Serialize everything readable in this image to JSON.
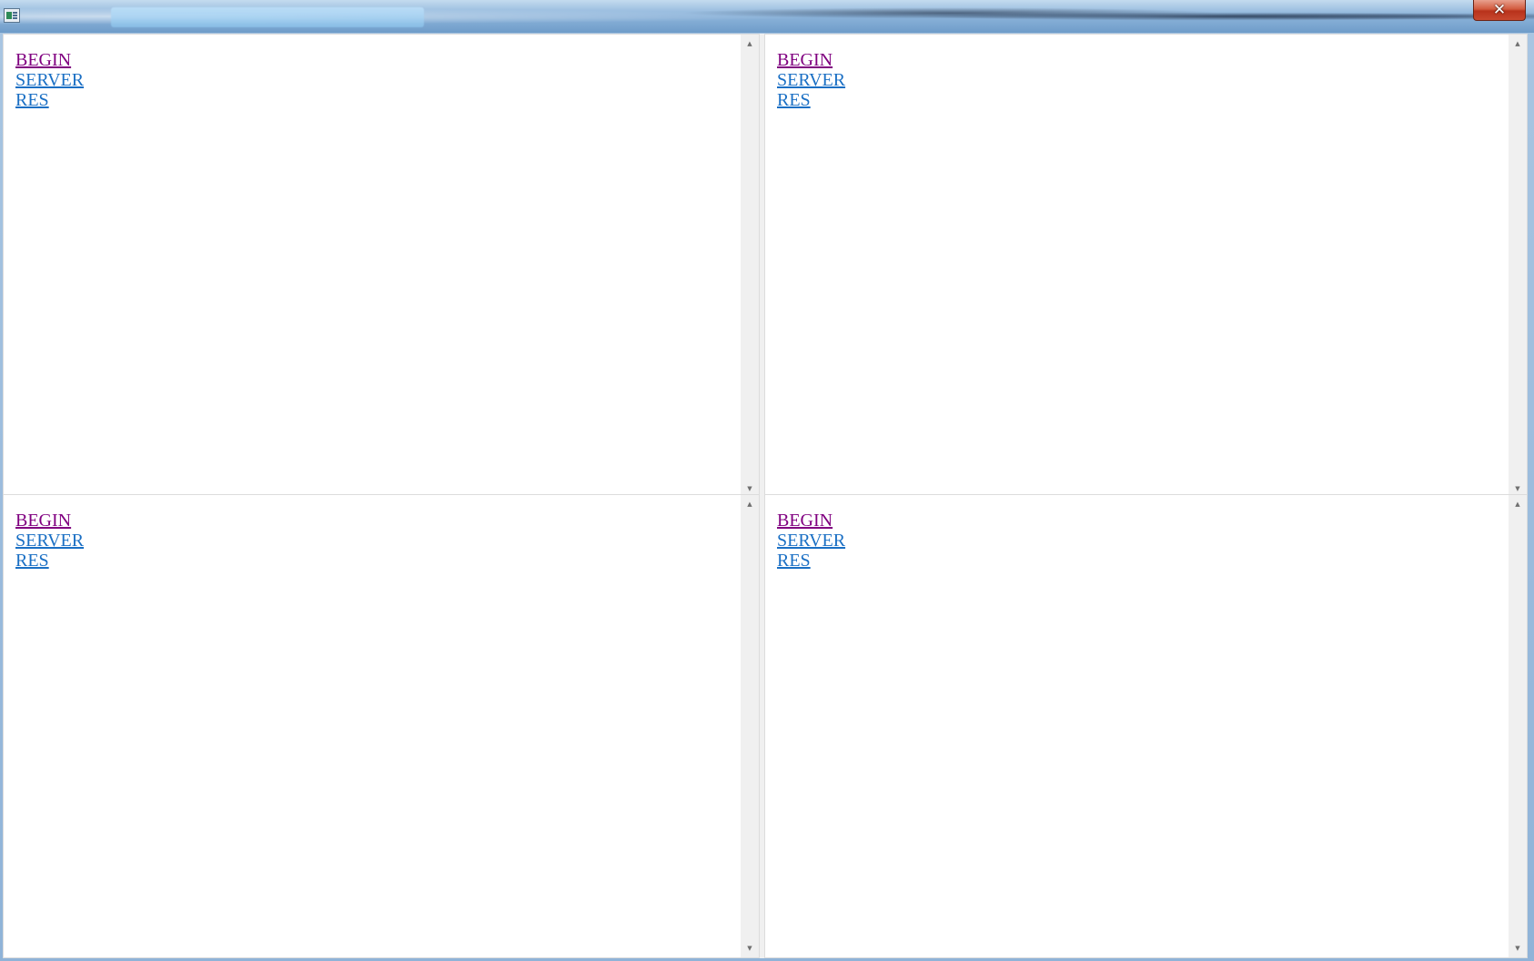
{
  "window": {
    "close_label": "✕"
  },
  "panes": [
    {
      "links": [
        {
          "label": "BEGIN",
          "state": "visited"
        },
        {
          "label": "SERVER",
          "state": "unvisited"
        },
        {
          "label": "RES",
          "state": "unvisited"
        }
      ]
    },
    {
      "links": [
        {
          "label": "BEGIN",
          "state": "visited"
        },
        {
          "label": "SERVER",
          "state": "unvisited"
        },
        {
          "label": "RES",
          "state": "unvisited"
        }
      ]
    },
    {
      "links": [
        {
          "label": "BEGIN",
          "state": "visited"
        },
        {
          "label": "SERVER",
          "state": "unvisited"
        },
        {
          "label": "RES",
          "state": "unvisited"
        }
      ]
    },
    {
      "links": [
        {
          "label": "BEGIN",
          "state": "visited"
        },
        {
          "label": "SERVER",
          "state": "unvisited"
        },
        {
          "label": "RES",
          "state": "unvisited"
        }
      ]
    }
  ],
  "scroll_arrows": {
    "up": "▲",
    "down": "▼"
  },
  "colors": {
    "visited_link": "#800080",
    "unvisited_link": "#1a6fc4",
    "close_button": "#c8472e"
  }
}
